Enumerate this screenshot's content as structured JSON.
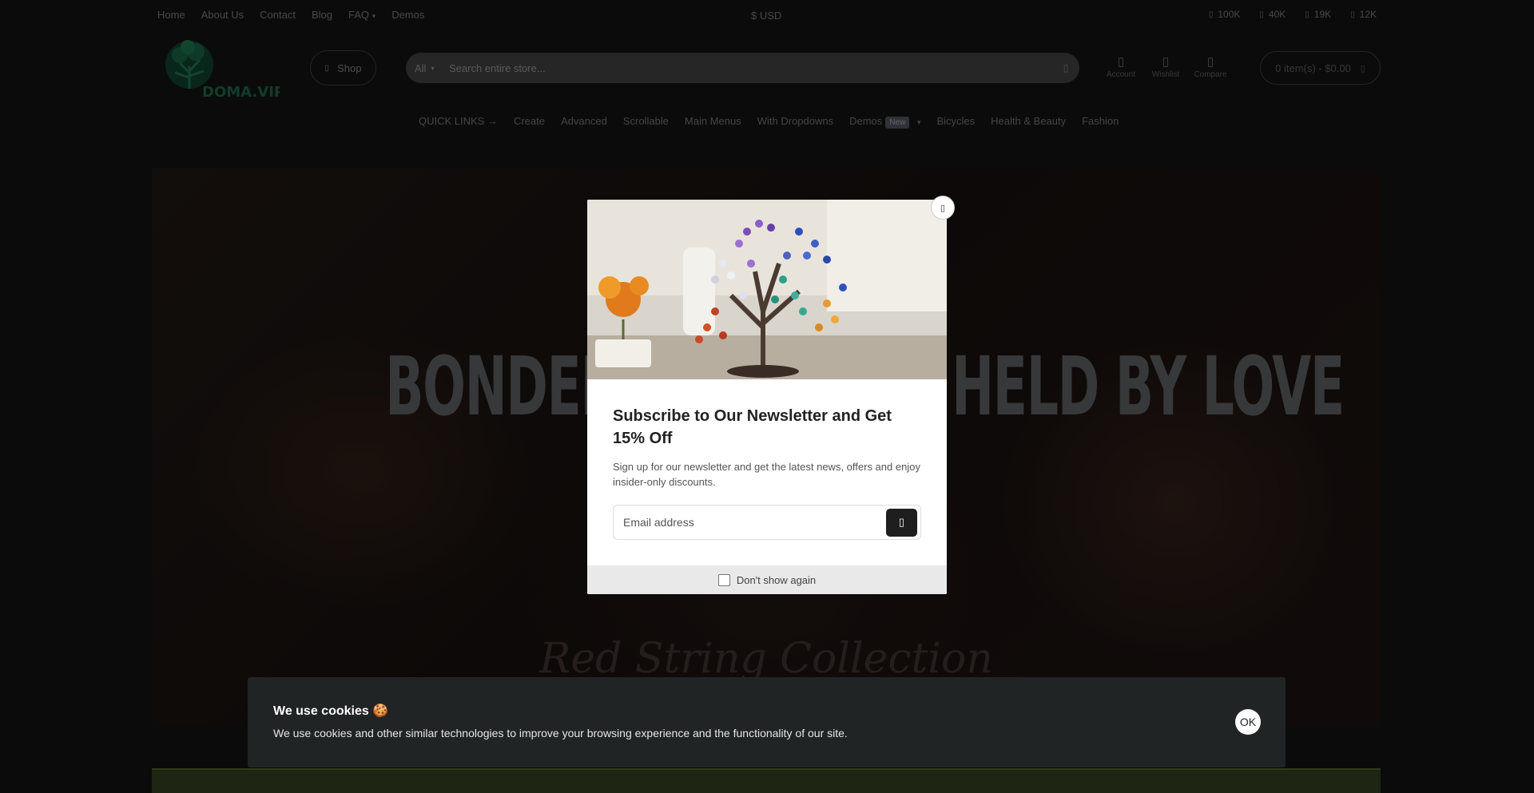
{
  "topbar": {
    "nav": [
      "Home",
      "About Us",
      "Contact",
      "Blog",
      "FAQ",
      "Demos"
    ],
    "faq_caret": "▾",
    "currency": "$ USD",
    "social": [
      {
        "icon": "facebook-icon",
        "count": "100K"
      },
      {
        "icon": "twitter-icon",
        "count": "40K"
      },
      {
        "icon": "instagram-icon",
        "count": "19K"
      },
      {
        "icon": "youtube-icon",
        "count": "12K"
      }
    ]
  },
  "header": {
    "logo_text": "DOMA.VIP",
    "shop_label": "Shop",
    "search": {
      "category": "All",
      "placeholder": "Search entire store..."
    },
    "icons": [
      {
        "icon": "user-icon",
        "label": "Account"
      },
      {
        "icon": "heart-icon",
        "label": "Wishlist"
      },
      {
        "icon": "compare-icon",
        "label": "Compare"
      }
    ],
    "cart_label": "0 item(s) - $0.00"
  },
  "mainnav": {
    "quick_links": "QUICK LINKS →",
    "items": [
      "Create",
      "Advanced",
      "Scrollable",
      "Main Menus",
      "With Dropdowns"
    ],
    "demos": "Demos",
    "demos_badge": "New",
    "items_after": [
      "Bicycles",
      "Health & Beauty",
      "Fashion"
    ]
  },
  "hero": {
    "title": "BONDED BY BLOOD, HELD BY LOVE",
    "script": "Red String Collection"
  },
  "modal": {
    "title": "Subscribe to Our Newsletter and Get 15% Off",
    "text": "Sign up for our newsletter and get the latest news, offers and enjoy insider-only discounts.",
    "email_placeholder": "Email address",
    "dont_show": "Don't show again"
  },
  "cookie": {
    "title": "We use cookies 🍪",
    "text": "We use cookies and other similar technologies to improve your browsing experience and the functionality of our site.",
    "ok": "OK"
  }
}
